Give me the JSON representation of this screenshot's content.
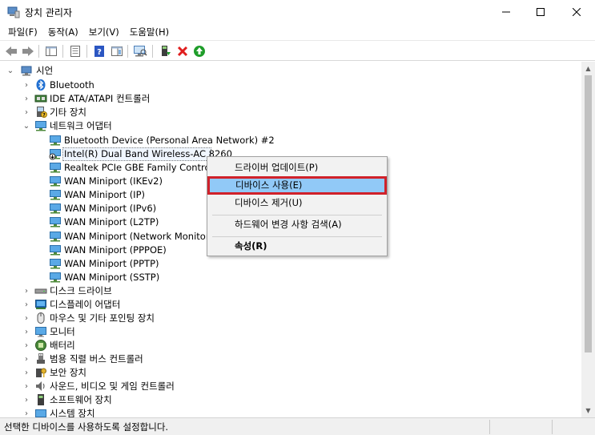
{
  "window": {
    "title": "장치 관리자",
    "controls": {
      "minimize": "–",
      "maximize": "☐",
      "close": "✕"
    }
  },
  "menu": [
    "파일(F)",
    "동작(A)",
    "보기(V)",
    "도움말(H)"
  ],
  "toolbar": {
    "icons": [
      "back-icon",
      "forward-icon",
      "show-hide-tree-icon",
      "properties-icon",
      "help-icon",
      "console-tree-icon",
      "scan-hardware-icon",
      "update-driver-icon",
      "uninstall-icon",
      "enable-device-icon"
    ],
    "colors": {
      "uninstall": "#e01e1e",
      "enable": "#1f9d2a",
      "help": "#2b56c2"
    }
  },
  "tree": {
    "root": "시언",
    "categories_top": [
      {
        "label": "Bluetooth",
        "icon": "bluetooth-icon",
        "expanded": false
      },
      {
        "label": "IDE ATA/ATAPI 컨트롤러",
        "icon": "ide-controller-icon",
        "expanded": false
      },
      {
        "label": "기타 장치",
        "icon": "other-devices-icon",
        "expanded": false
      },
      {
        "label": "네트워크 어댑터",
        "icon": "network-adapter-icon",
        "expanded": true
      }
    ],
    "network_children": [
      "Bluetooth Device (Personal Area Network) #2",
      "Intel(R) Dual Band Wireless-AC 8260",
      "Realtek PCIe GBE Family Controller",
      "WAN Miniport (IKEv2)",
      "WAN Miniport (IP)",
      "WAN Miniport (IPv6)",
      "WAN Miniport (L2TP)",
      "WAN Miniport (Network Monitor)",
      "WAN Miniport (PPPOE)",
      "WAN Miniport (PPTP)",
      "WAN Miniport (SSTP)"
    ],
    "selected_child_index": 1,
    "categories_bottom": [
      {
        "label": "디스크 드라이브",
        "icon": "disk-drive-icon"
      },
      {
        "label": "디스플레이 어댑터",
        "icon": "display-adapter-icon"
      },
      {
        "label": "마우스 및 기타 포인팅 장치",
        "icon": "mouse-icon"
      },
      {
        "label": "모니터",
        "icon": "monitor-icon"
      },
      {
        "label": "배터리",
        "icon": "battery-icon"
      },
      {
        "label": "범용 직렬 버스 컨트롤러",
        "icon": "usb-controller-icon"
      },
      {
        "label": "보안 장치",
        "icon": "security-device-icon"
      },
      {
        "label": "사운드, 비디오 및 게임 컨트롤러",
        "icon": "sound-icon"
      },
      {
        "label": "소프트웨어 장치",
        "icon": "software-device-icon"
      },
      {
        "label": "시스템 장치",
        "icon": "system-device-icon"
      }
    ]
  },
  "context_menu": {
    "items": [
      {
        "label": "드라이버 업데이트(P)",
        "bold": false
      },
      {
        "label": "디바이스 사용(E)",
        "bold": false,
        "highlighted": true
      },
      {
        "label": "디바이스 제거(U)",
        "bold": false
      },
      {
        "label": "하드웨어 변경 사항 검색(A)",
        "bold": false
      },
      {
        "label": "속성(R)",
        "bold": true
      }
    ],
    "highlight_color": "#91c9f7",
    "highlight_border_color": "#d0212a"
  },
  "status": {
    "text": "선택한 디바이스를 사용하도록 설정합니다."
  }
}
